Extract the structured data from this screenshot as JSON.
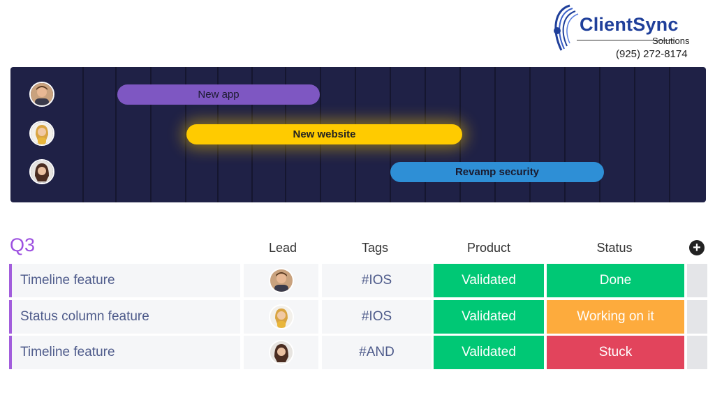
{
  "logo": {
    "name": "ClientSync",
    "subtitle": "Solutions",
    "phone": "(925) 272-8174",
    "brand_color": "#1f3f9a"
  },
  "timeline": {
    "background": "#1f2146",
    "rows": [
      {
        "label": "New app",
        "color": "#7e57c2",
        "avatar": "man-avatar"
      },
      {
        "label": "New website",
        "color": "#ffcb00",
        "avatar": "woman-blonde-avatar"
      },
      {
        "label": "Revamp security",
        "color": "#2e8fd6",
        "avatar": "woman-brunette-avatar"
      }
    ]
  },
  "board": {
    "group_title": "Q3",
    "group_color": "#9c4fe0",
    "columns": {
      "lead": "Lead",
      "tags": "Tags",
      "product": "Product",
      "status": "Status"
    },
    "add_column_icon": "plus-circle-icon",
    "rows": [
      {
        "name": "Timeline feature",
        "tag": "#IOS",
        "product": "Validated",
        "product_color": "#00c875",
        "status": "Done",
        "status_color": "#00c875"
      },
      {
        "name": "Status column feature",
        "tag": "#IOS",
        "product": "Validated",
        "product_color": "#00c875",
        "status": "Working on it",
        "status_color": "#fdab3d"
      },
      {
        "name": "Timeline feature",
        "tag": "#AND",
        "product": "Validated",
        "product_color": "#00c875",
        "status": "Stuck",
        "status_color": "#e2445c"
      }
    ]
  }
}
